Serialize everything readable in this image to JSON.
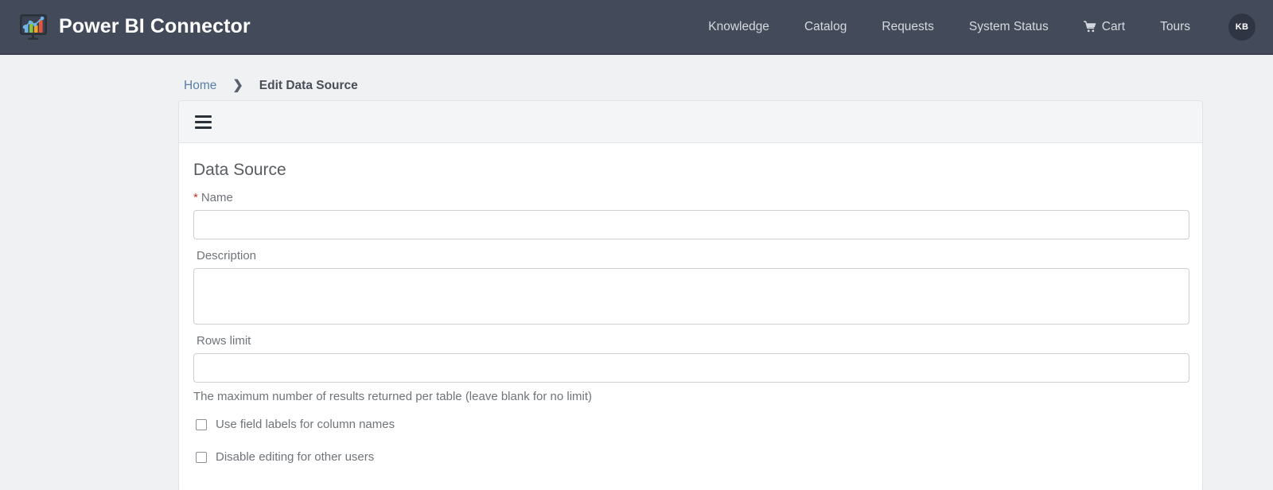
{
  "navbar": {
    "brand_title": "Power BI Connector",
    "logo_icon": "power-bi-chart-monitor-icon",
    "links": [
      {
        "label": "Knowledge",
        "icon": null
      },
      {
        "label": "Catalog",
        "icon": null
      },
      {
        "label": "Requests",
        "icon": null
      },
      {
        "label": "System Status",
        "icon": null
      },
      {
        "label": "Cart",
        "icon": "shopping-cart-icon"
      },
      {
        "label": "Tours",
        "icon": null
      }
    ],
    "avatar_initials": "KB",
    "background_color": "#434a59"
  },
  "breadcrumb": {
    "home_label": "Home",
    "separator": "❯",
    "current_label": "Edit Data Source",
    "link_color": "#5a7fa8"
  },
  "card": {
    "menu_icon": "hamburger-menu-icon",
    "section_title": "Data Source",
    "fields": {
      "name": {
        "label": "Name",
        "required": true,
        "required_marker": "*",
        "value": "",
        "placeholder": ""
      },
      "description": {
        "label": "Description",
        "required": false,
        "value": "",
        "placeholder": ""
      },
      "rows_limit": {
        "label": "Rows limit",
        "required": false,
        "value": "",
        "placeholder": "",
        "help_text": "The maximum number of results returned per table (leave blank for no limit)"
      }
    },
    "checkboxes": [
      {
        "label": "Use field labels for column names",
        "checked": false
      },
      {
        "label": "Disable editing for other users",
        "checked": false
      }
    ]
  },
  "colors": {
    "required_asterisk": "#c0392b",
    "page_background": "#f0f1f3",
    "card_header_background": "#f4f5f6",
    "border": "#e2e3e5"
  }
}
